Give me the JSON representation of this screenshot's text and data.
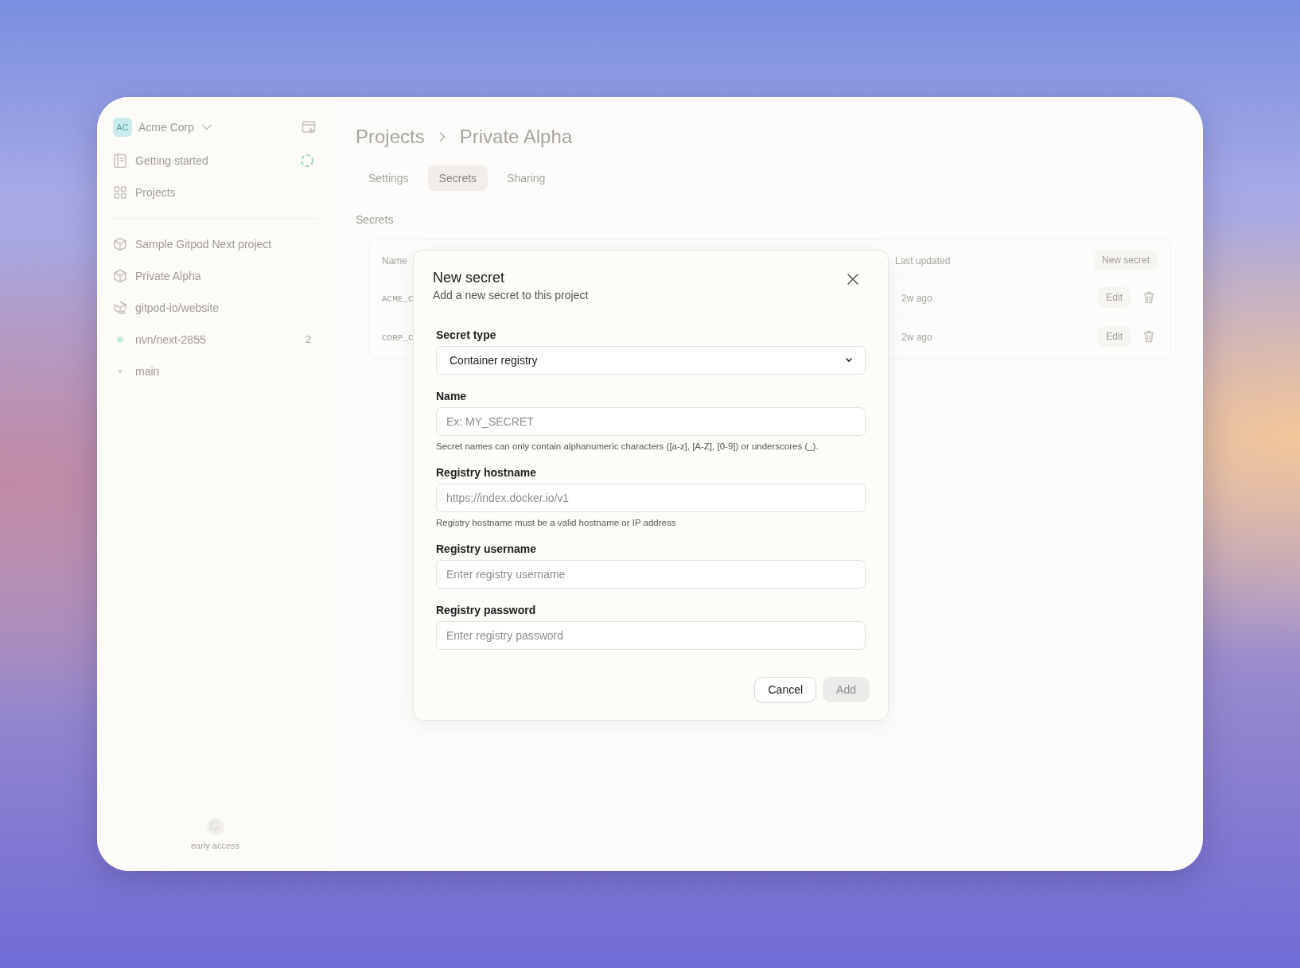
{
  "sidebar": {
    "org": {
      "avatar": "AC",
      "name": "Acme Corp"
    },
    "nav": [
      {
        "kind": "doc",
        "label": "Getting started",
        "busy": true
      },
      {
        "kind": "grid",
        "label": "Projects",
        "busy": false
      }
    ],
    "projects": [
      {
        "kind": "box",
        "label": "Sample Gitpod Next project"
      },
      {
        "kind": "box",
        "label": "Private Alpha"
      },
      {
        "kind": "repo",
        "label": "gitpod-io/website"
      },
      {
        "kind": "branch-active",
        "label": "nvn/next-2855",
        "badge": "2"
      },
      {
        "kind": "branch",
        "label": "main"
      }
    ],
    "footer": {
      "label": "early access"
    }
  },
  "breadcrumb": [
    "Projects",
    "Private Alpha"
  ],
  "tabs": [
    {
      "label": "Settings",
      "selected": false
    },
    {
      "label": "Secrets",
      "selected": true
    },
    {
      "label": "Sharing",
      "selected": false
    }
  ],
  "section_title": "Secrets",
  "table": {
    "columns": [
      {
        "kind": "name",
        "label": "Name"
      },
      {
        "kind": "updated",
        "label": "Last updated"
      }
    ],
    "new_button": "New secret",
    "rows": [
      {
        "name": "ACME_C",
        "updated": "2w ago",
        "action": "Edit"
      },
      {
        "name": "CORP_C",
        "updated": "2w ago",
        "action": "Edit"
      }
    ]
  },
  "dialog": {
    "title": "New secret",
    "subtitle": "Add a new secret to this project",
    "fields": [
      {
        "kind": "select",
        "label": "Secret type",
        "value": "Container registry"
      },
      {
        "kind": "text",
        "label": "Name",
        "placeholder": "Ex: MY_SECRET",
        "hint": "Secret names can only contain alphanumeric characters ([a-z], [A-Z], [0-9]) or underscores (_)."
      },
      {
        "kind": "text",
        "label": "Registry hostname",
        "placeholder": "https://index.docker.io/v1",
        "hint": "Registry hostname must be a valid hostname or IP address"
      },
      {
        "kind": "text",
        "label": "Registry username",
        "placeholder": "Enter registry username"
      },
      {
        "kind": "text",
        "label": "Registry password",
        "placeholder": "Enter registry password"
      }
    ],
    "buttons": [
      {
        "label": "Cancel",
        "disabled": false
      },
      {
        "label": "Add",
        "disabled": true
      }
    ]
  }
}
